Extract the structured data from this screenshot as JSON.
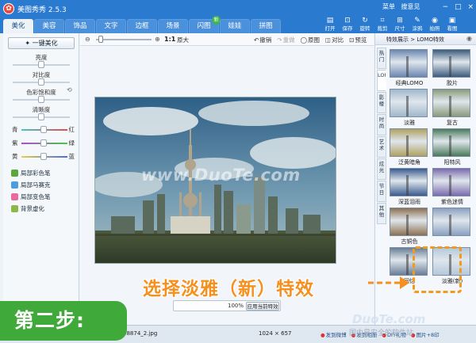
{
  "app": {
    "title": "美图秀秀 2.5.3",
    "menu": [
      "菜单",
      "搜意见"
    ],
    "window_controls": [
      "−",
      "□",
      "×"
    ]
  },
  "tabs": [
    {
      "label": "美化",
      "active": true
    },
    {
      "label": "美容"
    },
    {
      "label": "饰品"
    },
    {
      "label": "文字"
    },
    {
      "label": "边框"
    },
    {
      "label": "场景"
    },
    {
      "label": "闪图",
      "badge": "新"
    },
    {
      "label": "娃娃"
    },
    {
      "label": "拼图"
    }
  ],
  "toolbar_right": [
    {
      "icon": "open-icon",
      "label": "打开",
      "glyph": "▤"
    },
    {
      "icon": "save-icon",
      "label": "保存",
      "glyph": "⊡"
    },
    {
      "icon": "rotate-icon",
      "label": "旋转",
      "glyph": "↻"
    },
    {
      "icon": "crop-icon",
      "label": "裁剪",
      "glyph": "⌗"
    },
    {
      "icon": "size-icon",
      "label": "尺寸",
      "glyph": "⊞"
    },
    {
      "icon": "eraser-icon",
      "label": "涂鸦",
      "glyph": "✎"
    },
    {
      "icon": "camera-icon",
      "label": "拍照",
      "glyph": "◉"
    },
    {
      "icon": "browse-icon",
      "label": "看图",
      "glyph": "▣"
    }
  ],
  "left_panel": {
    "auto_button": "一键美化",
    "sliders": [
      {
        "label": "亮度",
        "value": 0.5
      },
      {
        "label": "对比度",
        "value": 0.5
      },
      {
        "label": "色彩饱和度",
        "value": 0.5
      },
      {
        "label": "清晰度",
        "value": 0.5
      }
    ],
    "color_balance": [
      {
        "left": "青",
        "right": "红",
        "gradient": [
          "#3ec8c8",
          "#e84a4a"
        ]
      },
      {
        "left": "紫",
        "right": "绿",
        "gradient": [
          "#b04ad0",
          "#4ac84a"
        ]
      },
      {
        "left": "黄",
        "right": "蓝",
        "gradient": [
          "#e8d03a",
          "#4a6ae8"
        ]
      }
    ],
    "brushes": [
      {
        "label": "局部彩色笔",
        "color": "#5aa73a"
      },
      {
        "label": "局部马赛克",
        "color": "#4a9ee0"
      },
      {
        "label": "局部变色笔",
        "color": "#e86aa0"
      },
      {
        "label": "背景虚化",
        "color": "#8ab84a"
      }
    ]
  },
  "canvas_toolbar": {
    "zoom_ratio": "1:1",
    "original_size": "原大",
    "actions": [
      {
        "glyph": "↶",
        "label": "撤销"
      },
      {
        "glyph": "↷",
        "label": "重做",
        "disabled": true
      },
      {
        "glyph": "◯",
        "label": "原图"
      },
      {
        "glyph": "◫",
        "label": "对比"
      },
      {
        "glyph": "⊡",
        "label": "预览"
      }
    ]
  },
  "canvas": {
    "watermark": "www.DuoTe.com",
    "compare_percent": "100%",
    "compare_button": "应用当前特效"
  },
  "status": {
    "filename": "48874_2.jpg",
    "dimensions": "1024 × 657",
    "links": [
      "发到微博",
      "发到相册",
      "DIY礼物",
      "图片+8印"
    ]
  },
  "right_panel": {
    "breadcrumb": "特效展示 > LOMO特效",
    "categories": [
      {
        "label": "热门"
      },
      {
        "label": "LOMO",
        "active": true
      },
      {
        "label": "影楼"
      },
      {
        "label": "时尚"
      },
      {
        "label": "艺术"
      },
      {
        "label": "炫光"
      },
      {
        "label": "节日"
      },
      {
        "label": "其他"
      }
    ],
    "effects": [
      {
        "label": "经典LOMO",
        "tone": "#6a86b0"
      },
      {
        "label": "胶片",
        "tone": "#3c5a7c"
      },
      {
        "label": "淡雅",
        "tone": "#9fb8cc"
      },
      {
        "label": "复古",
        "tone": "#8a9a7a"
      },
      {
        "label": "泛黄暗角",
        "tone": "#b0a060"
      },
      {
        "label": "阳特风",
        "tone": "#4a7a5a"
      },
      {
        "label": "深蓝泪雨",
        "tone": "#3a5a8e"
      },
      {
        "label": "紫色迷情",
        "tone": "#7a6aae"
      },
      {
        "label": "古铜色",
        "tone": "#8c7050"
      },
      {
        "label": "",
        "tone": "#8aa0c0"
      },
      {
        "label": "回忆",
        "tone": "#6a7e96"
      },
      {
        "label": "淡雅(新)",
        "tone": "#b4c8da",
        "new": true
      }
    ]
  },
  "overlay": {
    "callout": "选择淡雅（新）特效",
    "step": "第二步:",
    "site_watermark": "DuoTe.com",
    "site_tagline": "国内最安全的软件站"
  }
}
